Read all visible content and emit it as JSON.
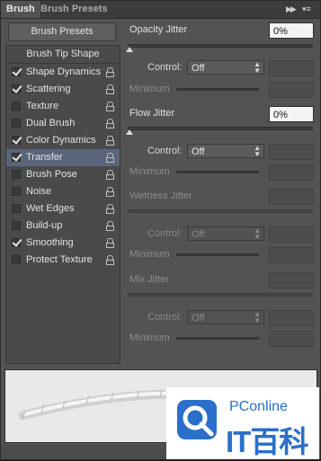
{
  "tabs": {
    "brush": "Brush",
    "brush_presets": "Brush Presets"
  },
  "left": {
    "presets_button": "Brush Presets",
    "tip_shape": "Brush Tip Shape",
    "items": [
      {
        "label": "Shape Dynamics",
        "checked": true,
        "selected": false
      },
      {
        "label": "Scattering",
        "checked": true,
        "selected": false
      },
      {
        "label": "Texture",
        "checked": false,
        "selected": false
      },
      {
        "label": "Dual Brush",
        "checked": false,
        "selected": false
      },
      {
        "label": "Color Dynamics",
        "checked": true,
        "selected": false
      },
      {
        "label": "Transfer",
        "checked": true,
        "selected": true
      },
      {
        "label": "Brush Pose",
        "checked": false,
        "selected": false
      },
      {
        "label": "Noise",
        "checked": false,
        "selected": false
      },
      {
        "label": "Wet Edges",
        "checked": false,
        "selected": false
      },
      {
        "label": "Build-up",
        "checked": false,
        "selected": false
      },
      {
        "label": "Smoothing",
        "checked": true,
        "selected": false
      },
      {
        "label": "Protect Texture",
        "checked": false,
        "selected": false
      }
    ]
  },
  "right": {
    "opacity_jitter": {
      "label": "Opacity Jitter",
      "value": "0%"
    },
    "flow_jitter": {
      "label": "Flow Jitter",
      "value": "0%"
    },
    "wetness_jitter": {
      "label": "Wetness Jitter"
    },
    "mix_jitter": {
      "label": "Mix Jitter"
    },
    "control_label": "Control:",
    "control_value": "Off",
    "minimum_label": "Minimum"
  },
  "watermark": {
    "brand": "PConline",
    "sub": "IT百科",
    "color": "#2a6fc9"
  },
  "colors": {
    "panel": "#535353",
    "selected_row": "#59657a",
    "preview_bg": "#e9e9e9"
  }
}
